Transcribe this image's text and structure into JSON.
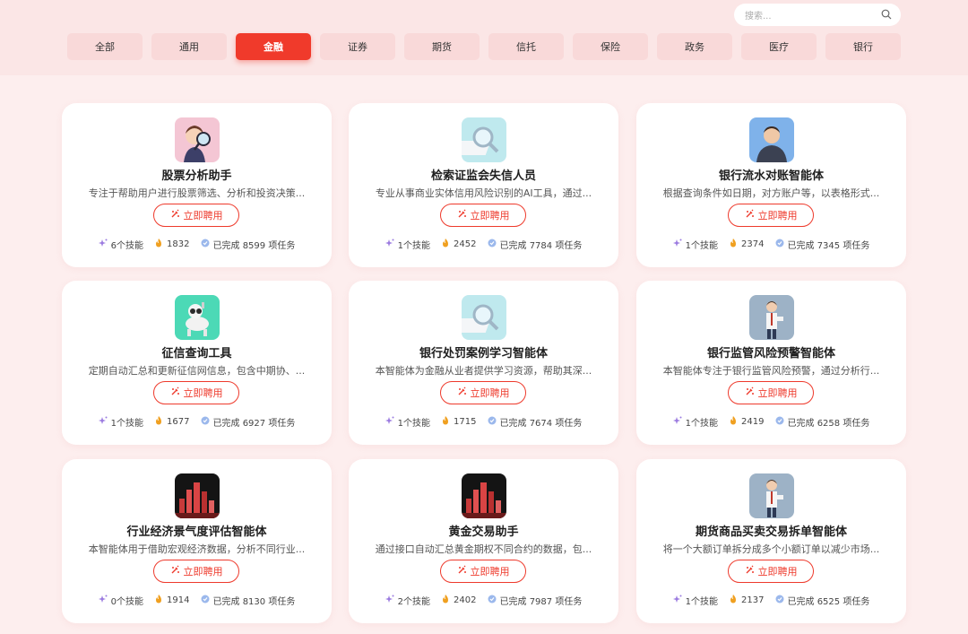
{
  "search": {
    "placeholder": "搜索..."
  },
  "tabs": [
    "全部",
    "通用",
    "金融",
    "证券",
    "期货",
    "信托",
    "保险",
    "政务",
    "医疗",
    "银行"
  ],
  "active_tab": "金融",
  "hire_label": "立即聘用",
  "completed_prefix": "已完成",
  "tasks_suffix": "项任务",
  "skills_suffix": "个技能",
  "colors": {
    "accent": "#f03a2b",
    "tab_bg": "#f9d9d9",
    "page_bg": "#fdeeee"
  },
  "cards": [
    {
      "title": "股票分析助手",
      "desc": "专注于帮助用户进行股票筛选、分析和投资决策...",
      "skills": "6",
      "hot": "1832",
      "tasks": "8599",
      "avatar": "detective-avatar"
    },
    {
      "title": "检索证监会失信人员",
      "desc": "专业从事商业实体信用风险识别的AI工具，通过...",
      "skills": "1",
      "hot": "2452",
      "tasks": "7784",
      "avatar": "magnifier-avatar"
    },
    {
      "title": "银行流水对账智能体",
      "desc": "根据查询条件如日期，对方账户等，以表格形式...",
      "skills": "1",
      "hot": "2374",
      "tasks": "7345",
      "avatar": "man-avatar"
    },
    {
      "title": "征信查询工具",
      "desc": "定期自动汇总和更新征信网信息，包含中期协、...",
      "skills": "1",
      "hot": "1677",
      "tasks": "6927",
      "avatar": "robot-dog-avatar"
    },
    {
      "title": "银行处罚案例学习智能体",
      "desc": "本智能体为金融从业者提供学习资源，帮助其深...",
      "skills": "1",
      "hot": "1715",
      "tasks": "7674",
      "avatar": "magnifier-avatar"
    },
    {
      "title": "银行监管风险预警智能体",
      "desc": "本智能体专注于银行监管风险预警，通过分析行...",
      "skills": "1",
      "hot": "2419",
      "tasks": "6258",
      "avatar": "businessman-avatar"
    },
    {
      "title": "行业经济景气度评估智能体",
      "desc": "本智能体用于借助宏观经济数据，分析不同行业...",
      "skills": "0",
      "hot": "1914",
      "tasks": "8130",
      "avatar": "bar-chart-avatar"
    },
    {
      "title": "黄金交易助手",
      "desc": "通过接口自动汇总黄金期权不同合约的数据，包...",
      "skills": "2",
      "hot": "2402",
      "tasks": "7987",
      "avatar": "bar-chart-avatar"
    },
    {
      "title": "期货商品买卖交易拆单智能体",
      "desc": "将一个大额订单拆分成多个小额订单以减少市场...",
      "skills": "1",
      "hot": "2137",
      "tasks": "6525",
      "avatar": "businessman-avatar"
    }
  ]
}
